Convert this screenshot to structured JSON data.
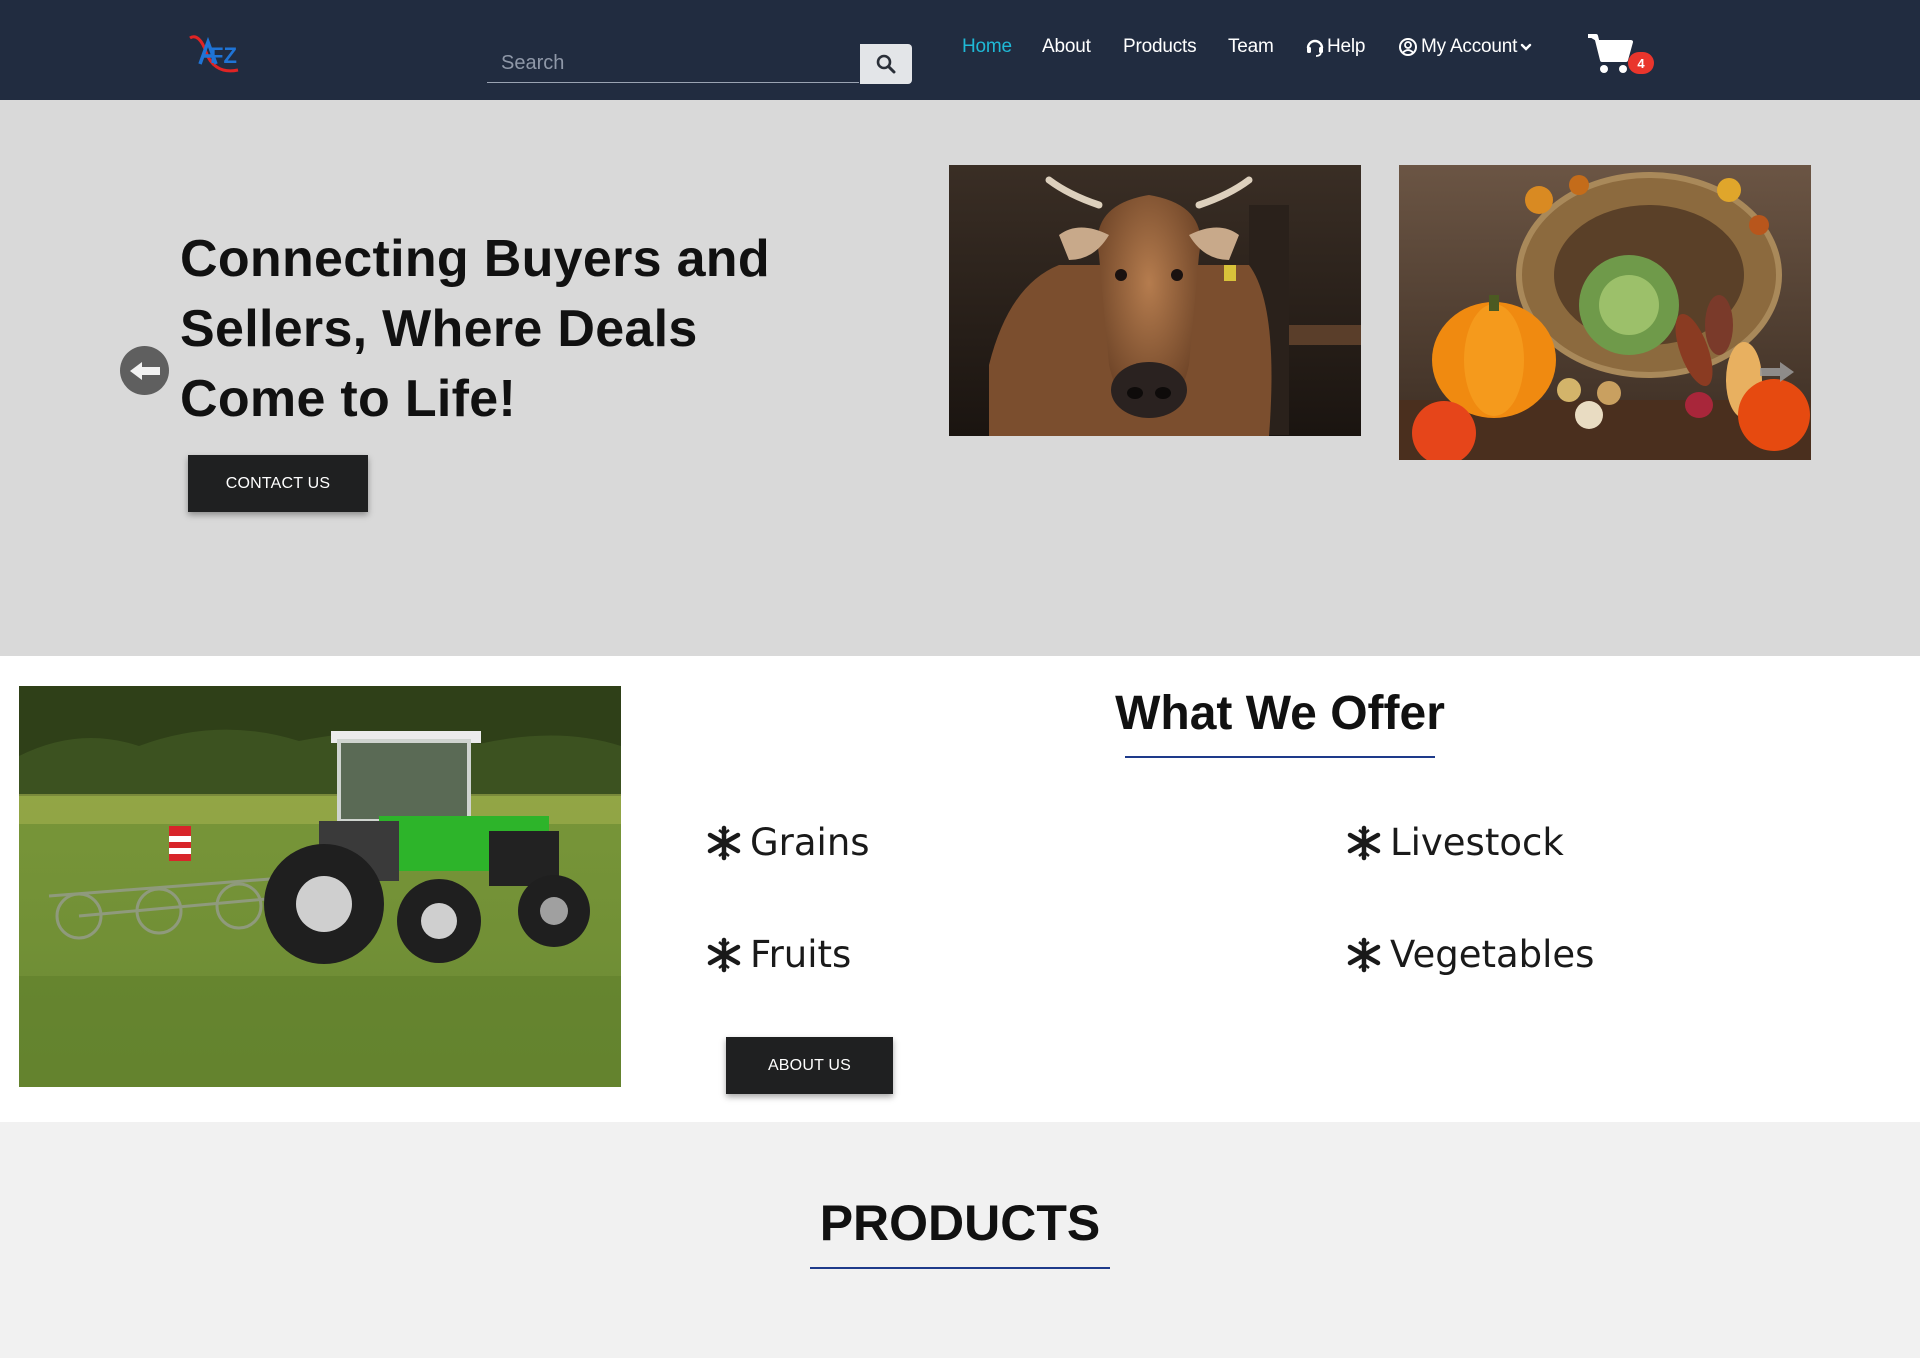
{
  "brand": {
    "logo_text": "FZ",
    "logo_accent": "#e02424",
    "logo_blue": "#1f74d6"
  },
  "search": {
    "placeholder": "Search"
  },
  "nav": {
    "items": [
      {
        "label": "Home",
        "active": true
      },
      {
        "label": "About"
      },
      {
        "label": "Products"
      },
      {
        "label": "Team"
      },
      {
        "label": "Help",
        "icon": "headset-icon"
      },
      {
        "label": "My Account",
        "icon": "user-circle-icon",
        "dropdown": "chevron-down-icon"
      }
    ],
    "active_color": "#1fb9d6"
  },
  "cart": {
    "count": "4",
    "icon": "cart-icon",
    "badge_color": "#e9352c"
  },
  "hero": {
    "title": "Connecting Buyers and Sellers, Where Deals Come to Life!",
    "contact_label": "CONTACT US",
    "images": [
      "cow-photo",
      "harvest-vegetables-photo"
    ]
  },
  "offer": {
    "title": "What We Offer",
    "items": [
      "Grains",
      "Livestock",
      "Fruits",
      "Vegetables"
    ],
    "bullet_icon": "snowflake-icon",
    "about_label": "ABOUT US",
    "image": "tractor-photo"
  },
  "products": {
    "title": "PRODUCTS"
  },
  "colors": {
    "navbar": "#212c40",
    "hero_bg": "#d9d9d9",
    "underline": "#1e3a8a",
    "button": "#1f2021"
  }
}
